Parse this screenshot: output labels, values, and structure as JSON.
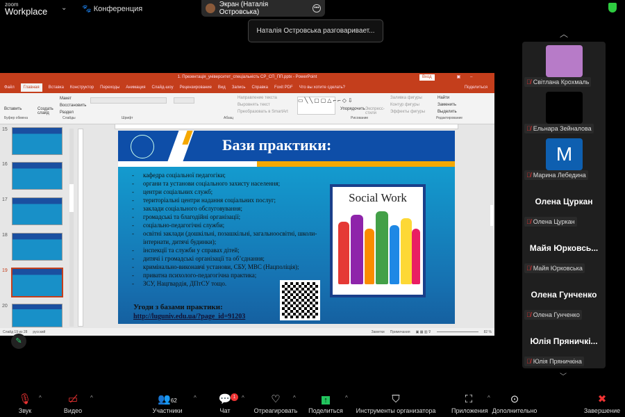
{
  "topbar": {
    "logo_small": "zoom",
    "logo_big": "Workplace",
    "meeting": "Конференция",
    "screen_share": "Экран (Наталія Островська)",
    "speaking_toast": "Наталія Островська разговаривает..."
  },
  "ppt": {
    "title": "1. Презентація_університет_спеціальність СР_СП_ПП.pptx - PowerPoint",
    "signin": "Вход",
    "tabs": [
      "Файл",
      "Главная",
      "Вставка",
      "Конструктор",
      "Переходы",
      "Анимация",
      "Слайд-шоу",
      "Рецензирование",
      "Вид",
      "Запись",
      "Справка",
      "Foxit PDF",
      "Что вы хотите сделать?"
    ],
    "share": "Поделиться",
    "ribbon": {
      "paste": "Вставить",
      "new_slide": "Создать слайд",
      "layout": "Макет",
      "reset": "Восстановить",
      "section": "Раздел",
      "text_dir": "Направление текста",
      "align_text": "Выровнять текст",
      "smartart": "Преобразовать в SmartArt",
      "arrange": "Упорядочить",
      "quick_styles": "Экспресс-стили",
      "fill": "Заливка фигуры",
      "outline": "Контур фигуры",
      "effects": "Эффекты фигуры",
      "find": "Найти",
      "replace": "Заменить",
      "select": "Выделить",
      "groups": [
        "Буфер обмена",
        "Слайды",
        "Шрифт",
        "Абзац",
        "Рисование",
        "Редактирование"
      ]
    },
    "thumbs": [
      "15",
      "16",
      "17",
      "18",
      "19",
      "20"
    ],
    "status": {
      "slide": "Слайд 19 из 28",
      "lang": "русский",
      "notes": "Заметки",
      "comments": "Примечания",
      "zoom": "82 %"
    }
  },
  "slide": {
    "title": "Бази практики:",
    "items": [
      "кафедра соціальної педагогіки;",
      "органи та установи соціального захисту населення;",
      "центри соціальних служб;",
      "територіальні центри надання соціальних послуг;",
      " заклади соціального обслуговування;",
      "громадські та благодійні організації;",
      "соціально-педагогічні служби;",
      "освітні заклади (дошкільні, позашкільні, загальноосвітні, школи-інтернати, дитячі будинки);",
      "інспекції та служби у справах дітей;",
      "дитячі і громадські організації та об’єднання;",
      "кримінально-виконавчі установи, СБУ, МВС (Нацполіція);",
      " приватна психолого-педагогічна практика;",
      "ЗСУ, Нацгвардія, ДПтСУ тощо."
    ],
    "agreements": "Угоди з базами практики:",
    "link": "http://luguniv.edu.ua/?page_id=91203",
    "image_text": "Social Work"
  },
  "participants": [
    {
      "name": "Світлана Крохмаль",
      "type": "image",
      "color": "#b77bc8"
    },
    {
      "name": "Ельнара Зейналова",
      "type": "video",
      "color": "#000000"
    },
    {
      "name": "Марина Лебедина",
      "type": "letter",
      "letter": "M",
      "color": "#0e5fb0"
    },
    {
      "name": "Олена Цуркан",
      "big": "Олена Цуркан"
    },
    {
      "name": "Майя Юрковська",
      "big": "Майя  Юрковсь..."
    },
    {
      "name": "Олена Гунченко",
      "big": "Олена Гунченко"
    },
    {
      "name": "Юлія Пряничкіна",
      "big": "Юлія  Пряничкі..."
    }
  ],
  "toolbar": {
    "audio": "Звук",
    "video": "Видео",
    "participants": "Участники",
    "participants_count": "62",
    "chat": "Чат",
    "chat_badge": "1",
    "react": "Отреагировать",
    "share": "Поделиться",
    "host_tools": "Инструменты организатора",
    "apps": "Приложения",
    "more": "Дополнительно",
    "end": "Завершение"
  }
}
